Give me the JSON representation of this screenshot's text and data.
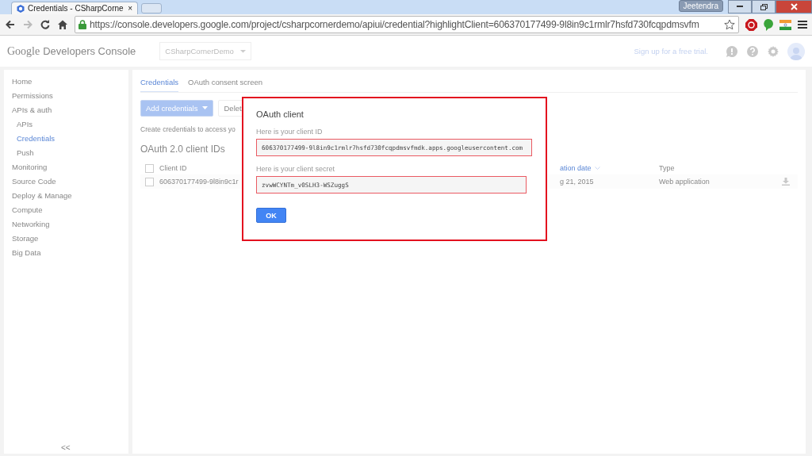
{
  "browser": {
    "tabs": [
      {
        "title": "Credentials - CSharpCorne",
        "close": "×",
        "selected": true
      }
    ],
    "user": "Jeetendra",
    "url": "https://console.developers.google.com/project/csharpcornerdemo/apiui/credential?highlightClient=606370177499-9l8in9c1rmlr7hsfd730fcqpdmsvfm"
  },
  "header": {
    "logo": "Google",
    "product": "Developers Console",
    "project": "CSharpCornerDemo",
    "trial_link": "Sign up for a free trial."
  },
  "sidebar": {
    "items": [
      {
        "label": "Home",
        "selected": false
      },
      {
        "label": "Permissions",
        "selected": false
      },
      {
        "label": "APIs & auth",
        "selected": false,
        "children": [
          {
            "label": "APIs",
            "selected": false
          },
          {
            "label": "Credentials",
            "selected": true
          },
          {
            "label": "Push",
            "selected": false
          }
        ]
      },
      {
        "label": "Monitoring",
        "selected": false
      },
      {
        "label": "Source Code",
        "selected": false
      },
      {
        "label": "Deploy & Manage",
        "selected": false
      },
      {
        "label": "Compute",
        "selected": false
      },
      {
        "label": "Networking",
        "selected": false
      },
      {
        "label": "Storage",
        "selected": false
      },
      {
        "label": "Big Data",
        "selected": false
      }
    ],
    "collapse": "<<"
  },
  "tabs": [
    {
      "label": "Credentials",
      "selected": true
    },
    {
      "label": "OAuth consent screen",
      "selected": false
    }
  ],
  "toolbar": {
    "add_button": "Add credentials",
    "delete_button": "Delet"
  },
  "hint": "Create credentials to access yo",
  "section_title": "OAuth 2.0 client IDs",
  "table": {
    "select_all_checked": false,
    "columns": [
      "Client ID",
      "ation date",
      "Type"
    ],
    "rows": [
      {
        "cells": [
          "606370177499-9l8in9c1r",
          "g 21, 2015",
          "Web application"
        ],
        "checked": false
      }
    ]
  },
  "dialog": {
    "title": "OAuth client",
    "id_label": "Here is your client ID",
    "client_id": "606370177499-9l8in9c1rmlr7hsfd730fcqpdmsvfmdk.apps.googleusercontent.com",
    "secret_label": "Here is your client secret",
    "client_secret": "zvwWCYNTm_v0SLH3-WSZuggS",
    "ok": "OK"
  }
}
